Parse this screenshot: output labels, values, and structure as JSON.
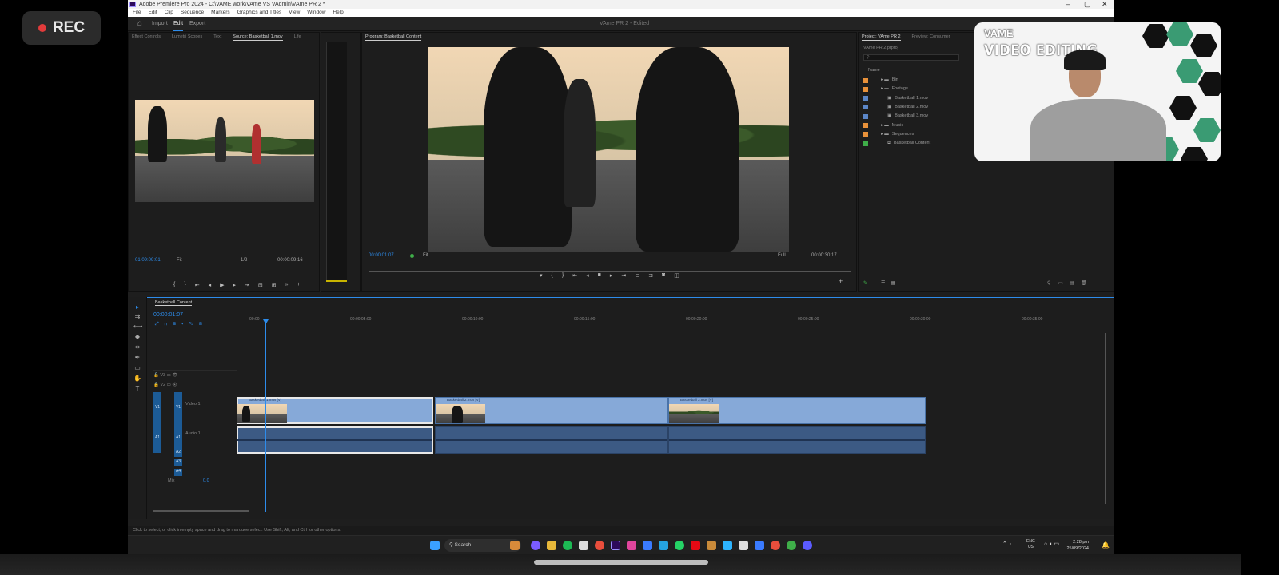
{
  "recording": {
    "label": "REC",
    "dot_color": "#e23b3b"
  },
  "window": {
    "title": "Adobe Premiere Pro 2024 - C:\\VAME work\\VAme VS VAdmin\\VAme PR 2 *",
    "controls": [
      "–",
      "▢",
      "✕"
    ]
  },
  "menu": [
    "File",
    "Edit",
    "Clip",
    "Sequence",
    "Markers",
    "Graphics and Titles",
    "View",
    "Window",
    "Help"
  ],
  "workspace": {
    "tabs": [
      "Import",
      "Edit",
      "Export"
    ],
    "active": "Edit",
    "document": "VAme PR 2 - Edited"
  },
  "source_panel": {
    "tabs": [
      "Effect Controls",
      "Lumetri Scopes",
      "Text",
      "Source: Basketball 1.mov",
      "Life"
    ],
    "timecode_in": "01:09:09:01",
    "fit": "Fit",
    "ratio": "1/2",
    "duration": "00:00:09:16"
  },
  "program_panel": {
    "title": "Program: Basketball Content",
    "timecode": "00:00:01:07",
    "fit": "Fit",
    "quality": "Full",
    "duration": "00:00:30:17"
  },
  "project_panel": {
    "tabs": [
      "Project: VAme PR 2",
      "Preview: Consumer"
    ],
    "project_name": "VAme PR 2.prproj",
    "column": "Name",
    "items": [
      {
        "label": "Bin",
        "color": "#e8913a",
        "indent": 1,
        "type": "bin"
      },
      {
        "label": "Footage",
        "color": "#e8913a",
        "indent": 1,
        "type": "bin"
      },
      {
        "label": "Basketball 1.mov",
        "color": "#5b86c7",
        "indent": 2,
        "type": "clip"
      },
      {
        "label": "Basketball 2.mov",
        "color": "#5b86c7",
        "indent": 2,
        "type": "clip"
      },
      {
        "label": "Basketball 3.mov",
        "color": "#5b86c7",
        "indent": 2,
        "type": "clip"
      },
      {
        "label": "Music",
        "color": "#e8913a",
        "indent": 1,
        "type": "bin"
      },
      {
        "label": "Sequences",
        "color": "#e8913a",
        "indent": 1,
        "type": "bin"
      },
      {
        "label": "Basketball Content",
        "color": "#3fae49",
        "indent": 2,
        "type": "seq"
      }
    ]
  },
  "webcam": {
    "brand": "VAME",
    "title": "VIDEO EDITING",
    "accent_colors": [
      "#3a9b73",
      "#111111"
    ]
  },
  "timeline": {
    "sequence_tab": "Basketball Content",
    "timecode": "00:00:01:07",
    "ruler": [
      "00:00",
      "00:00:05:00",
      "00:00:10:00",
      "00:00:15:00",
      "00:00:20:00",
      "00:00:25:00",
      "00:00:30:00",
      "00:00:35:00"
    ],
    "tracks": {
      "v3": "V3",
      "v2": "V2",
      "v1": "V1",
      "v1_name": "Video 1",
      "a1": "A1",
      "a1_name": "Audio 1",
      "a2": "A2",
      "a3": "A3",
      "a4": "A4",
      "mix": "Mix",
      "mix_value": "0.0"
    },
    "clips": [
      "Basketball 1.mov [V]",
      "Basketball 2.mov [V]",
      "Basketball 3.mov [V]"
    ]
  },
  "status_text": "Click to select, or click in empty space and drag to marquee select. Use Shift, Alt, and Ctrl for other options.",
  "taskbar": {
    "search_placeholder": "Search",
    "lang": "ENG",
    "region": "US",
    "time": "2:28 pm",
    "date": "25/09/2024"
  }
}
